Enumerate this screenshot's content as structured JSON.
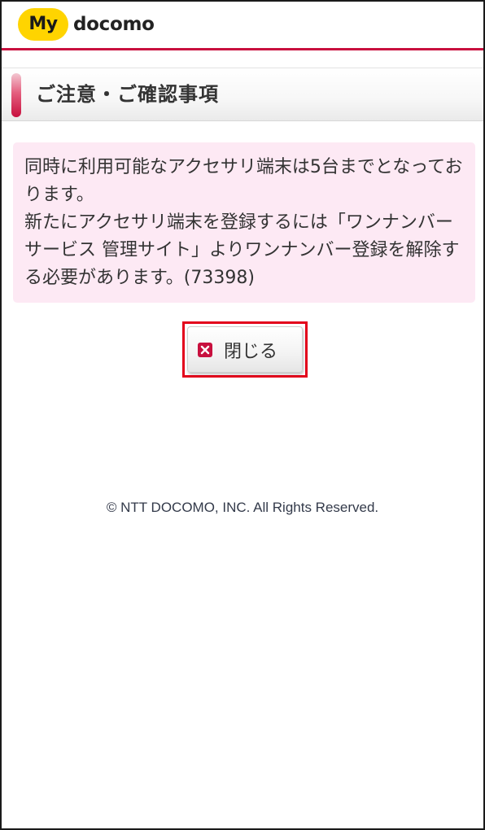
{
  "header": {
    "logo_my": "My",
    "logo_docomo": "docomo",
    "accent_color": "#c8103e",
    "logo_badge_color": "#ffd400"
  },
  "section": {
    "title": "ご注意・ご確認事項"
  },
  "notice": {
    "line1": "同時に利用可能なアクセサリ端末は5台までとなっております。",
    "line2": "新たにアクセサリ端末を登録するには「ワンナンバーサービス 管理サイト」よりワンナンバー登録を解除する必要があります。(73398)",
    "background_color": "#fde9f4"
  },
  "close_button": {
    "label": "閉じる",
    "icon": "close-icon"
  },
  "footer": {
    "copyright": "© NTT DOCOMO, INC. All Rights Reserved."
  }
}
